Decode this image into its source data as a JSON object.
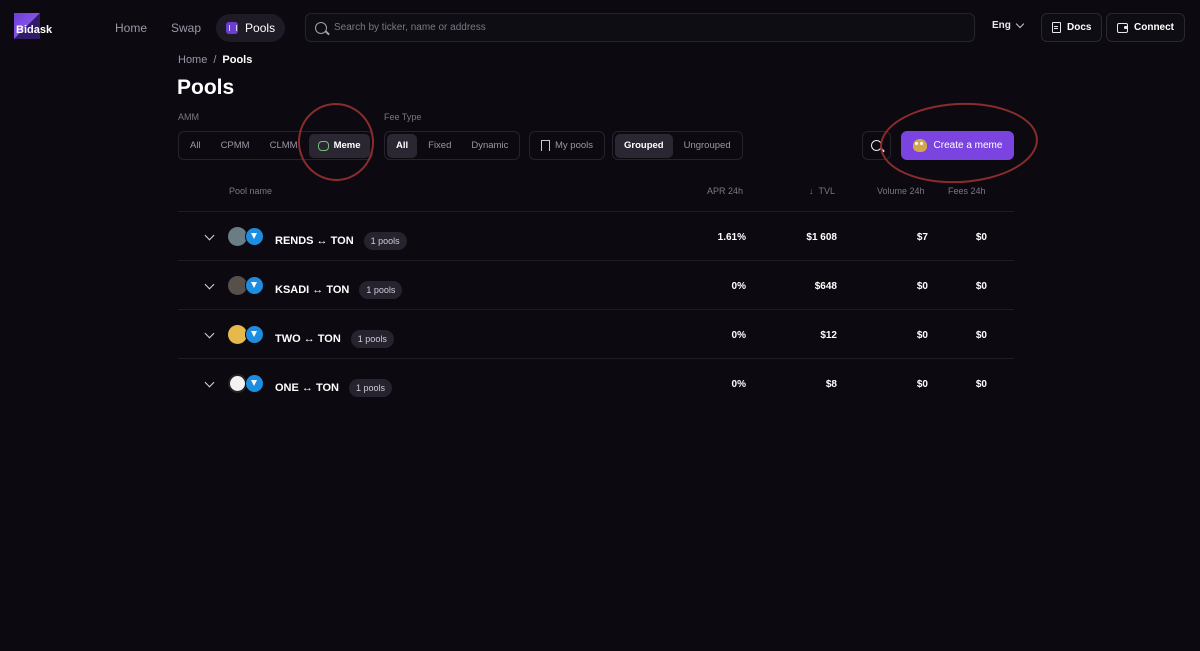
{
  "brand": {
    "name": "Bidask",
    "accent": "#7b44e0"
  },
  "nav": {
    "home": "Home",
    "swap": "Swap",
    "pools": "Pools"
  },
  "search": {
    "placeholder": "Search by ticker, name or address"
  },
  "header": {
    "lang": "Eng",
    "docs": "Docs",
    "connect": "Connect"
  },
  "breadcrumb": {
    "home": "Home",
    "sep": "/",
    "current": "Pools"
  },
  "page": {
    "title": "Pools"
  },
  "filters": {
    "amm_label": "AMM",
    "amm": [
      "All",
      "CPMM",
      "CLMM",
      "Meme"
    ],
    "amm_selected": "Meme",
    "fee_label": "Fee Type",
    "fee": [
      "All",
      "Fixed",
      "Dynamic"
    ],
    "fee_selected": "All",
    "my_pools": "My pools",
    "grouping": [
      "Grouped",
      "Ungrouped"
    ],
    "grouping_selected": "Grouped",
    "create": "Create a meme"
  },
  "table": {
    "headers": {
      "pool": "Pool name",
      "apr": "APR 24h",
      "sort_arrow": "↓",
      "tvl": "TVL",
      "volume": "Volume 24h",
      "fees": "Fees 24h"
    },
    "rows": [
      {
        "pair": "RENDS ↔ TON",
        "pools": "1 pools",
        "apr": "1.61%",
        "tvl": "$1 608",
        "volume": "$7",
        "fees": "$0",
        "token_color": "#6a7d86"
      },
      {
        "pair": "KSADI ↔ TON",
        "pools": "1 pools",
        "apr": "0%",
        "tvl": "$648",
        "volume": "$0",
        "fees": "$0",
        "token_color": "#55504a"
      },
      {
        "pair": "TWO ↔ TON",
        "pools": "1 pools",
        "apr": "0%",
        "tvl": "$12",
        "volume": "$0",
        "fees": "$0",
        "token_color": "#e6b94a"
      },
      {
        "pair": "ONE ↔ TON",
        "pools": "1 pools",
        "apr": "0%",
        "tvl": "$8",
        "volume": "$0",
        "fees": "$0",
        "token_color": "#f2f2f2"
      }
    ]
  }
}
